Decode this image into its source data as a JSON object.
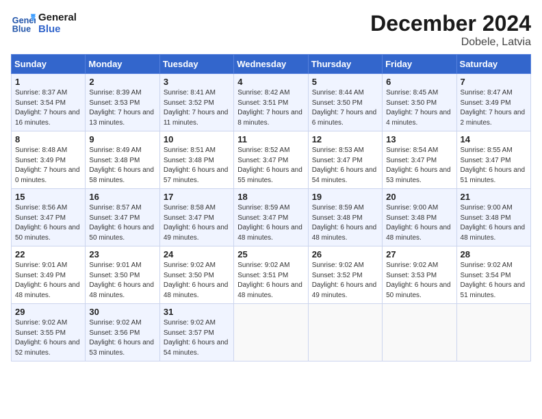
{
  "logo": {
    "line1": "General",
    "line2": "Blue"
  },
  "title": "December 2024",
  "location": "Dobele, Latvia",
  "days_of_week": [
    "Sunday",
    "Monday",
    "Tuesday",
    "Wednesday",
    "Thursday",
    "Friday",
    "Saturday"
  ],
  "weeks": [
    [
      {
        "day": "1",
        "rise": "8:37 AM",
        "set": "3:54 PM",
        "daylight": "7 hours and 16 minutes."
      },
      {
        "day": "2",
        "rise": "8:39 AM",
        "set": "3:53 PM",
        "daylight": "7 hours and 13 minutes."
      },
      {
        "day": "3",
        "rise": "8:41 AM",
        "set": "3:52 PM",
        "daylight": "7 hours and 11 minutes."
      },
      {
        "day": "4",
        "rise": "8:42 AM",
        "set": "3:51 PM",
        "daylight": "7 hours and 8 minutes."
      },
      {
        "day": "5",
        "rise": "8:44 AM",
        "set": "3:50 PM",
        "daylight": "7 hours and 6 minutes."
      },
      {
        "day": "6",
        "rise": "8:45 AM",
        "set": "3:50 PM",
        "daylight": "7 hours and 4 minutes."
      },
      {
        "day": "7",
        "rise": "8:47 AM",
        "set": "3:49 PM",
        "daylight": "7 hours and 2 minutes."
      }
    ],
    [
      {
        "day": "8",
        "rise": "8:48 AM",
        "set": "3:49 PM",
        "daylight": "7 hours and 0 minutes."
      },
      {
        "day": "9",
        "rise": "8:49 AM",
        "set": "3:48 PM",
        "daylight": "6 hours and 58 minutes."
      },
      {
        "day": "10",
        "rise": "8:51 AM",
        "set": "3:48 PM",
        "daylight": "6 hours and 57 minutes."
      },
      {
        "day": "11",
        "rise": "8:52 AM",
        "set": "3:47 PM",
        "daylight": "6 hours and 55 minutes."
      },
      {
        "day": "12",
        "rise": "8:53 AM",
        "set": "3:47 PM",
        "daylight": "6 hours and 54 minutes."
      },
      {
        "day": "13",
        "rise": "8:54 AM",
        "set": "3:47 PM",
        "daylight": "6 hours and 53 minutes."
      },
      {
        "day": "14",
        "rise": "8:55 AM",
        "set": "3:47 PM",
        "daylight": "6 hours and 51 minutes."
      }
    ],
    [
      {
        "day": "15",
        "rise": "8:56 AM",
        "set": "3:47 PM",
        "daylight": "6 hours and 50 minutes."
      },
      {
        "day": "16",
        "rise": "8:57 AM",
        "set": "3:47 PM",
        "daylight": "6 hours and 50 minutes."
      },
      {
        "day": "17",
        "rise": "8:58 AM",
        "set": "3:47 PM",
        "daylight": "6 hours and 49 minutes."
      },
      {
        "day": "18",
        "rise": "8:59 AM",
        "set": "3:47 PM",
        "daylight": "6 hours and 48 minutes."
      },
      {
        "day": "19",
        "rise": "8:59 AM",
        "set": "3:48 PM",
        "daylight": "6 hours and 48 minutes."
      },
      {
        "day": "20",
        "rise": "9:00 AM",
        "set": "3:48 PM",
        "daylight": "6 hours and 48 minutes."
      },
      {
        "day": "21",
        "rise": "9:00 AM",
        "set": "3:48 PM",
        "daylight": "6 hours and 48 minutes."
      }
    ],
    [
      {
        "day": "22",
        "rise": "9:01 AM",
        "set": "3:49 PM",
        "daylight": "6 hours and 48 minutes."
      },
      {
        "day": "23",
        "rise": "9:01 AM",
        "set": "3:50 PM",
        "daylight": "6 hours and 48 minutes."
      },
      {
        "day": "24",
        "rise": "9:02 AM",
        "set": "3:50 PM",
        "daylight": "6 hours and 48 minutes."
      },
      {
        "day": "25",
        "rise": "9:02 AM",
        "set": "3:51 PM",
        "daylight": "6 hours and 48 minutes."
      },
      {
        "day": "26",
        "rise": "9:02 AM",
        "set": "3:52 PM",
        "daylight": "6 hours and 49 minutes."
      },
      {
        "day": "27",
        "rise": "9:02 AM",
        "set": "3:53 PM",
        "daylight": "6 hours and 50 minutes."
      },
      {
        "day": "28",
        "rise": "9:02 AM",
        "set": "3:54 PM",
        "daylight": "6 hours and 51 minutes."
      }
    ],
    [
      {
        "day": "29",
        "rise": "9:02 AM",
        "set": "3:55 PM",
        "daylight": "6 hours and 52 minutes."
      },
      {
        "day": "30",
        "rise": "9:02 AM",
        "set": "3:56 PM",
        "daylight": "6 hours and 53 minutes."
      },
      {
        "day": "31",
        "rise": "9:02 AM",
        "set": "3:57 PM",
        "daylight": "6 hours and 54 minutes."
      },
      null,
      null,
      null,
      null
    ]
  ]
}
